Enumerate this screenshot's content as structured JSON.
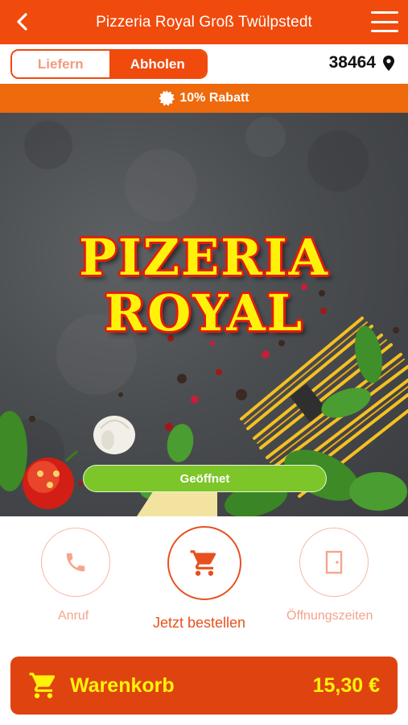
{
  "header": {
    "title": "Pizzeria Royal Groß Twülpstedt",
    "back_icon": "chevron-left-icon",
    "menu_icon": "hamburger-menu-icon"
  },
  "order_mode": {
    "options": [
      "Liefern",
      "Abholen"
    ],
    "selected": "Abholen"
  },
  "location": {
    "zip": "38464",
    "icon": "location-pin-icon"
  },
  "discount": {
    "label": "10% Rabatt",
    "icon": "badge-icon"
  },
  "hero": {
    "logo_line1": "PIZERIA",
    "logo_line2": "ROYAL",
    "status": "Geöffnet"
  },
  "actions": {
    "call": {
      "label": "Anruf",
      "icon": "phone-icon"
    },
    "order": {
      "label": "Jetzt bestellen",
      "icon": "shopping-cart-icon"
    },
    "hours": {
      "label": "Öffnungszeiten",
      "icon": "door-icon"
    }
  },
  "cart": {
    "label": "Warenkorb",
    "total": "15,30 €",
    "icon": "shopping-cart-icon"
  },
  "colors": {
    "primary": "#f04a0d",
    "discount_bar": "#ee6a0c",
    "cart_bg": "#df4310",
    "cart_text": "#fff20a",
    "status_green": "#7cc62a",
    "logo_yellow": "#fff20a",
    "logo_red": "#e11a10"
  }
}
